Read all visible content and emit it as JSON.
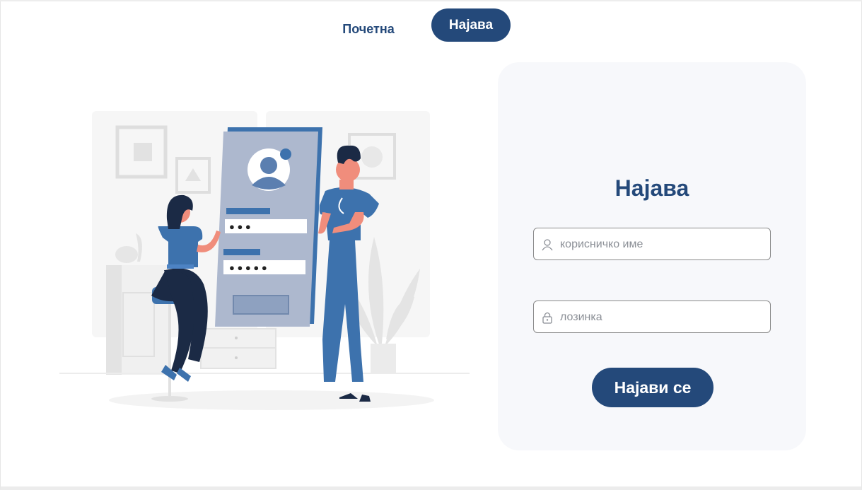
{
  "nav": {
    "home_label": "Почетна",
    "login_label": "Најава"
  },
  "login_card": {
    "title": "Најава",
    "username_placeholder": "корисничко име",
    "password_placeholder": "лозинка",
    "submit_label": "Најави се",
    "username_icon": "user-icon",
    "password_icon": "lock-icon"
  },
  "illustration": {
    "password_dots_short": "● ● ●",
    "password_dots_long": "● ● ● ● ●"
  },
  "colors": {
    "brand": "#24497a",
    "accent_blue": "#3d72ad",
    "card_bg": "#f7f8fb",
    "placeholder": "#8b8f96"
  }
}
